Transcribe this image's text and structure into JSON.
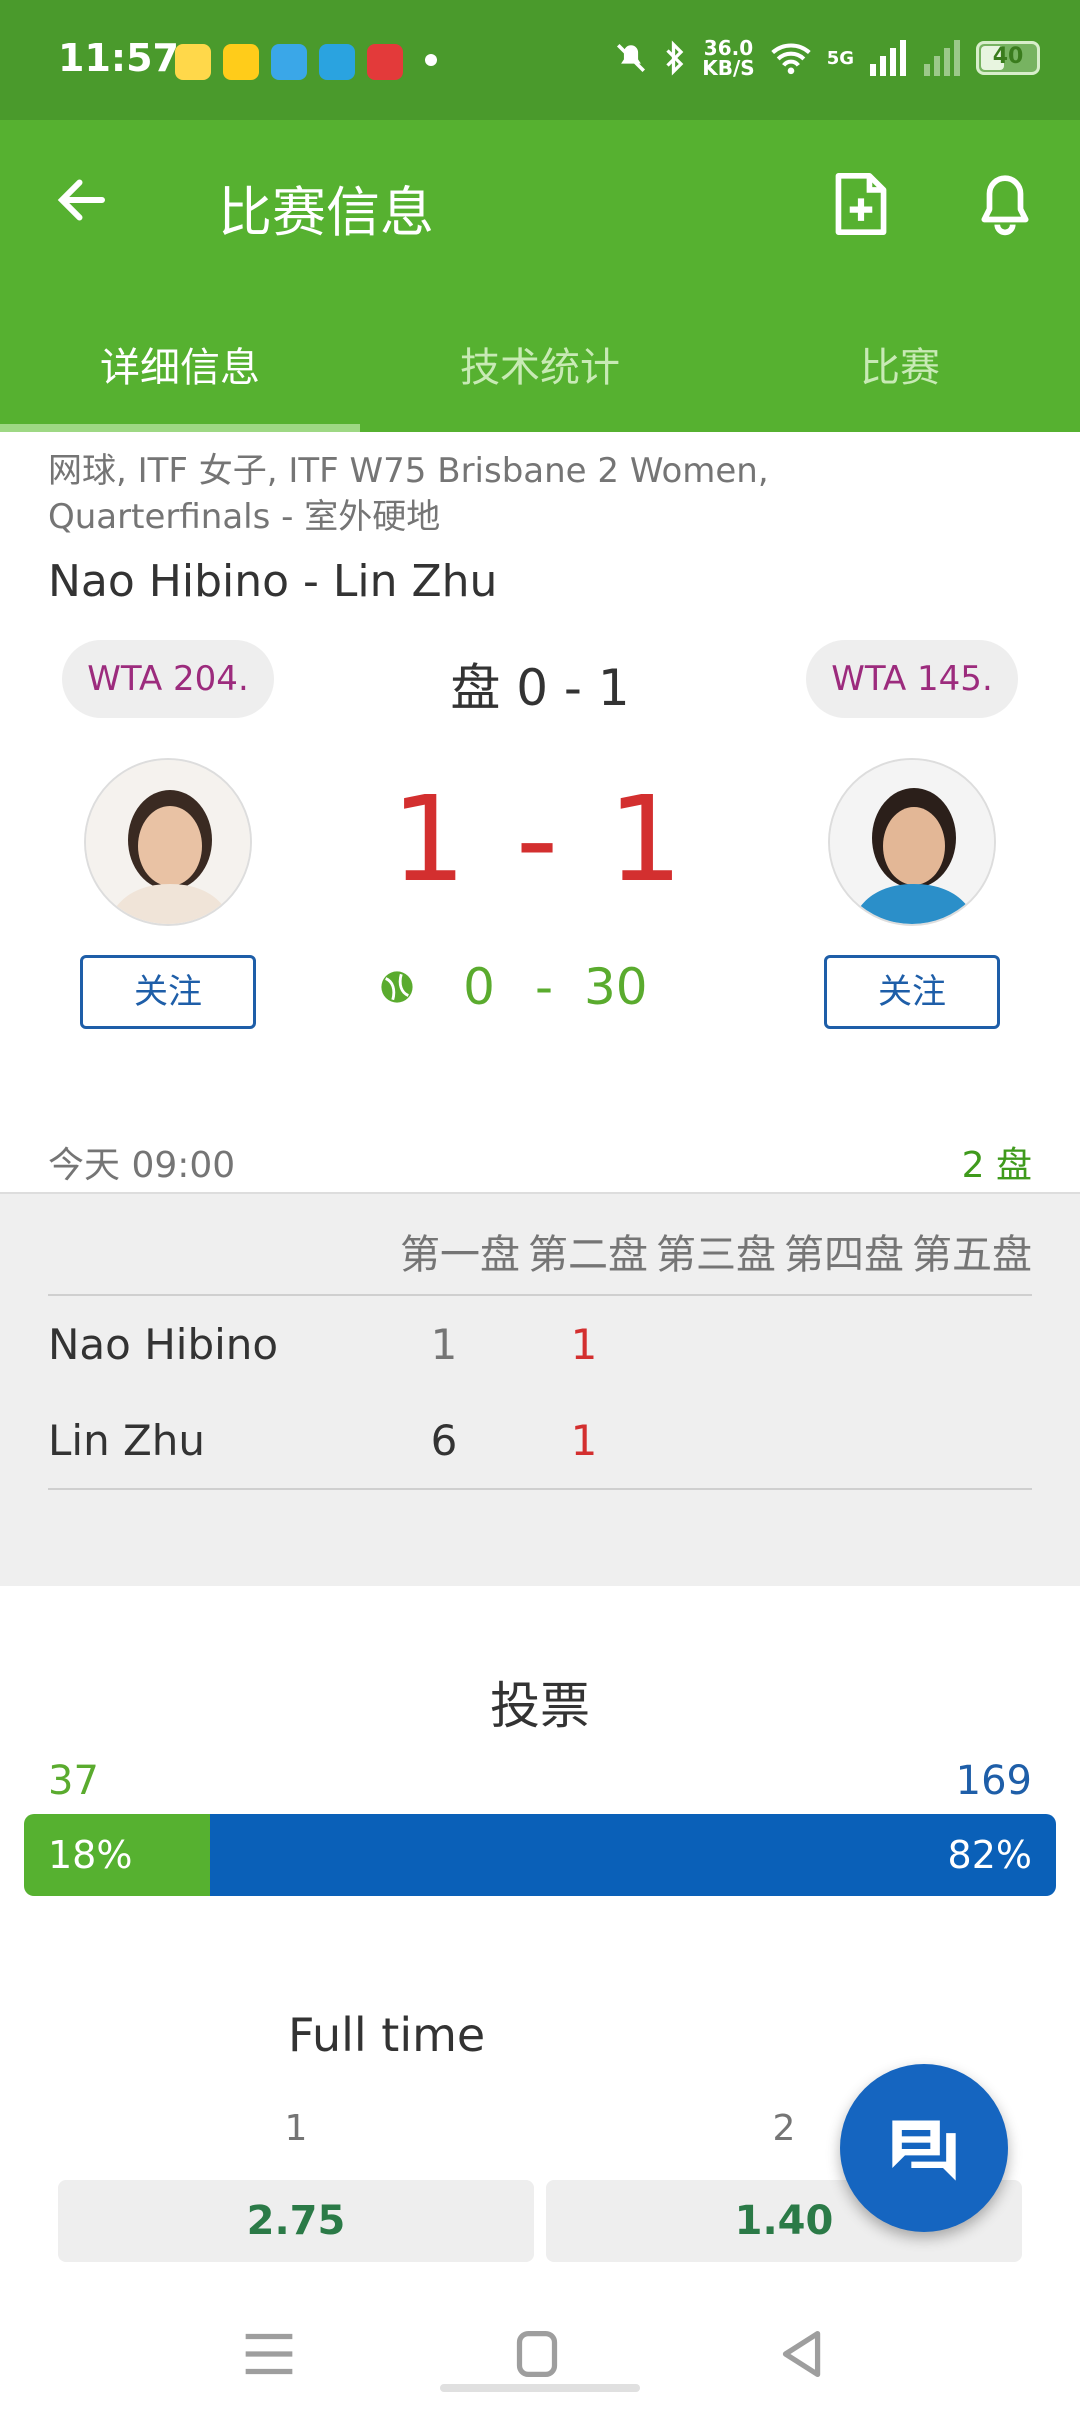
{
  "status_bar": {
    "time": "11:57",
    "net_speed": "36.0\nKB/S",
    "battery": "40",
    "signal_label": "5G"
  },
  "app_bar": {
    "title": "比赛信息"
  },
  "tabs": [
    {
      "label": "详细信息",
      "active": true
    },
    {
      "label": "技术统计",
      "active": false
    },
    {
      "label": "比赛",
      "active": false
    }
  ],
  "match": {
    "league": "网球, ITF 女子, ITF W75 Brisbane 2 Women, Quarterfinals - 室外硬地",
    "title": "Nao Hibino - Lin Zhu",
    "player1": {
      "rank": "WTA 204.",
      "follow": "关注",
      "name": "Nao Hibino"
    },
    "player2": {
      "rank": "WTA 145.",
      "follow": "关注",
      "name": "Lin Zhu"
    },
    "set_score": "盘 0 - 1",
    "game_score": "1 - 1",
    "point_score_p1": "0",
    "point_dash": "-",
    "point_score_p2": "30",
    "date": "今天 09:00",
    "sets_count": "2 盘"
  },
  "sets_table": {
    "headers": [
      "第一盘",
      "第二盘",
      "第三盘",
      "第四盘",
      "第五盘"
    ],
    "rows": [
      {
        "name": "Nao Hibino",
        "s1": "1",
        "s2": "1"
      },
      {
        "name": "Lin Zhu",
        "s1": "6",
        "s2": "1"
      }
    ]
  },
  "votes": {
    "title": "投票",
    "left_count": "37",
    "right_count": "169",
    "left_pct": "18%",
    "right_pct": "82%",
    "left_fraction": 0.18
  },
  "odds": {
    "title": "Full time",
    "label1": "1",
    "label2": "2",
    "odd1": "2.75",
    "odd2": "1.40"
  },
  "colors": {
    "primary_green": "#56b130",
    "dark_green": "#4a9a2c",
    "accent_blue": "#1565c0",
    "score_red": "#d32f2f",
    "rank_purple": "#9c2b7d"
  }
}
